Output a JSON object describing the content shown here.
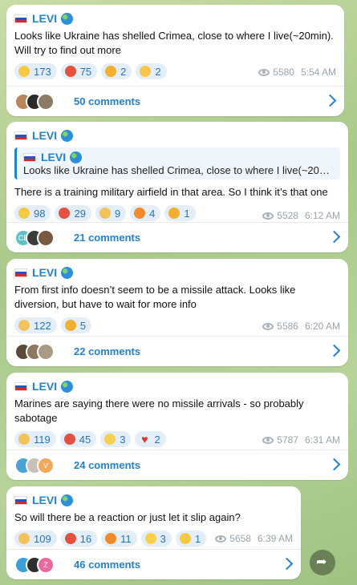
{
  "posts": [
    {
      "author": "LEVI",
      "text": "Looks like Ukraine has shelled Crimea, close to where I live(~20min). Will try to find out more",
      "reactions": [
        {
          "icon": "sad-face-icon",
          "count": "173"
        },
        {
          "icon": "angry-face-icon",
          "count": "75"
        },
        {
          "icon": "party-popper-icon",
          "count": "2"
        },
        {
          "icon": "clapping-hands-icon",
          "count": "2"
        }
      ],
      "views": "5580",
      "time": "5:54 AM",
      "comments": "50 comments"
    },
    {
      "author": "LEVI",
      "quote_author": "LEVI",
      "quote_text": "Looks like Ukraine has shelled Crimea, close to where I live(~20mi...",
      "text": "There is a training military airfield in that area. So I think it’s that one",
      "reactions": [
        {
          "icon": "sad-face-icon",
          "count": "98"
        },
        {
          "icon": "angry-face-icon",
          "count": "29"
        },
        {
          "icon": "thumbs-up-icon",
          "count": "9"
        },
        {
          "icon": "fire-icon",
          "count": "4"
        },
        {
          "icon": "party-popper-icon",
          "count": "1"
        }
      ],
      "views": "5528",
      "time": "6:12 AM",
      "comments": "21 comments",
      "avatar_initials": "CB"
    },
    {
      "author": "LEVI",
      "text": "From first info doesn’t seem to be a missile attack. Looks like diversion, but have to wait for more info",
      "reactions": [
        {
          "icon": "thumbs-up-icon",
          "count": "122"
        },
        {
          "icon": "party-popper-icon",
          "count": "5"
        }
      ],
      "views": "5586",
      "time": "6:20 AM",
      "comments": "22 comments"
    },
    {
      "author": "LEVI",
      "text": "Marines are saying there were no missile arrivals - so probably sabotage",
      "reactions": [
        {
          "icon": "thumbs-up-icon",
          "count": "119"
        },
        {
          "icon": "angry-face-icon",
          "count": "45"
        },
        {
          "icon": "grinning-face-icon",
          "count": "3"
        },
        {
          "icon": "heart-icon",
          "count": "2"
        }
      ],
      "views": "5787",
      "time": "6:31 AM",
      "comments": "24 comments",
      "avatar_initials": "V"
    },
    {
      "author": "LEVI",
      "text": "So will there be a reaction or just let it slip again?",
      "reactions": [
        {
          "icon": "thumbs-up-icon",
          "count": "109"
        },
        {
          "icon": "angry-face-icon",
          "count": "16"
        },
        {
          "icon": "fire-icon",
          "count": "11"
        },
        {
          "icon": "grinning-face-icon",
          "count": "3"
        },
        {
          "icon": "sad-face-icon",
          "count": "1"
        }
      ],
      "views": "5658",
      "time": "6:39 AM",
      "comments": "46 comments",
      "avatar_initials": "Z"
    }
  ],
  "colors": {
    "accent": "#2481cc",
    "reaction_bg": "#e4eef8",
    "wallpaper": "#b7d39a"
  }
}
